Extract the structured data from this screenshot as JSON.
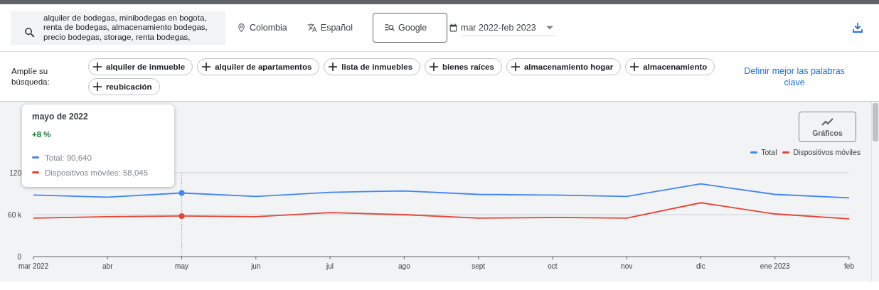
{
  "search": {
    "value": "alquiler de bodegas, minibodegas en bogota, renta de bodegas, almacenamiento bodegas, precio bodegas, storage, renta bodegas,"
  },
  "filters": {
    "location": "Colombia",
    "language": "Español",
    "network": "Google",
    "date_range": "mar 2022-feb 2023"
  },
  "broaden": {
    "label": "Amplíe su búsqueda:",
    "chips": [
      "alquiler de inmueble",
      "alquiler de apartamentos",
      "lista de inmuebles",
      "bienes raíces",
      "almacenamiento hogar",
      "almacenamiento",
      "reubicación"
    ],
    "refine_link": "Definir mejor las palabras clave"
  },
  "chart": {
    "graphs_button": "Gráficos",
    "tooltip": {
      "title": "mayo de 2022",
      "change": "+8 %",
      "lines": [
        {
          "text": "Total: 90,640",
          "color": "#4285f4"
        },
        {
          "text": "Dispositivos móviles: 58,045",
          "color": "#ea4335"
        }
      ]
    },
    "chart_data": {
      "type": "line",
      "categories": [
        "mar 2022",
        "abr",
        "may",
        "jun",
        "jul",
        "ago",
        "sept",
        "oct",
        "nov",
        "dic",
        "ene 2023",
        "feb"
      ],
      "series": [
        {
          "name": "Total",
          "color": "#4285f4",
          "values": [
            88,
            85,
            91,
            86,
            92,
            94,
            89,
            88,
            86,
            104,
            89,
            84
          ]
        },
        {
          "name": "Dispositivos móviles",
          "color": "#ea4335",
          "values": [
            55,
            57,
            58,
            57,
            63,
            60,
            55,
            56,
            55,
            77,
            61,
            54
          ]
        }
      ],
      "ylim": [
        0,
        120
      ],
      "yticks": [
        0,
        {
          "value": 60,
          "label": "60 k"
        },
        {
          "value": 120,
          "label": "120"
        }
      ],
      "ref_lines": [
        {
          "axis": "x",
          "value": "may"
        },
        {
          "axis": "y",
          "value": 60
        }
      ]
    }
  }
}
